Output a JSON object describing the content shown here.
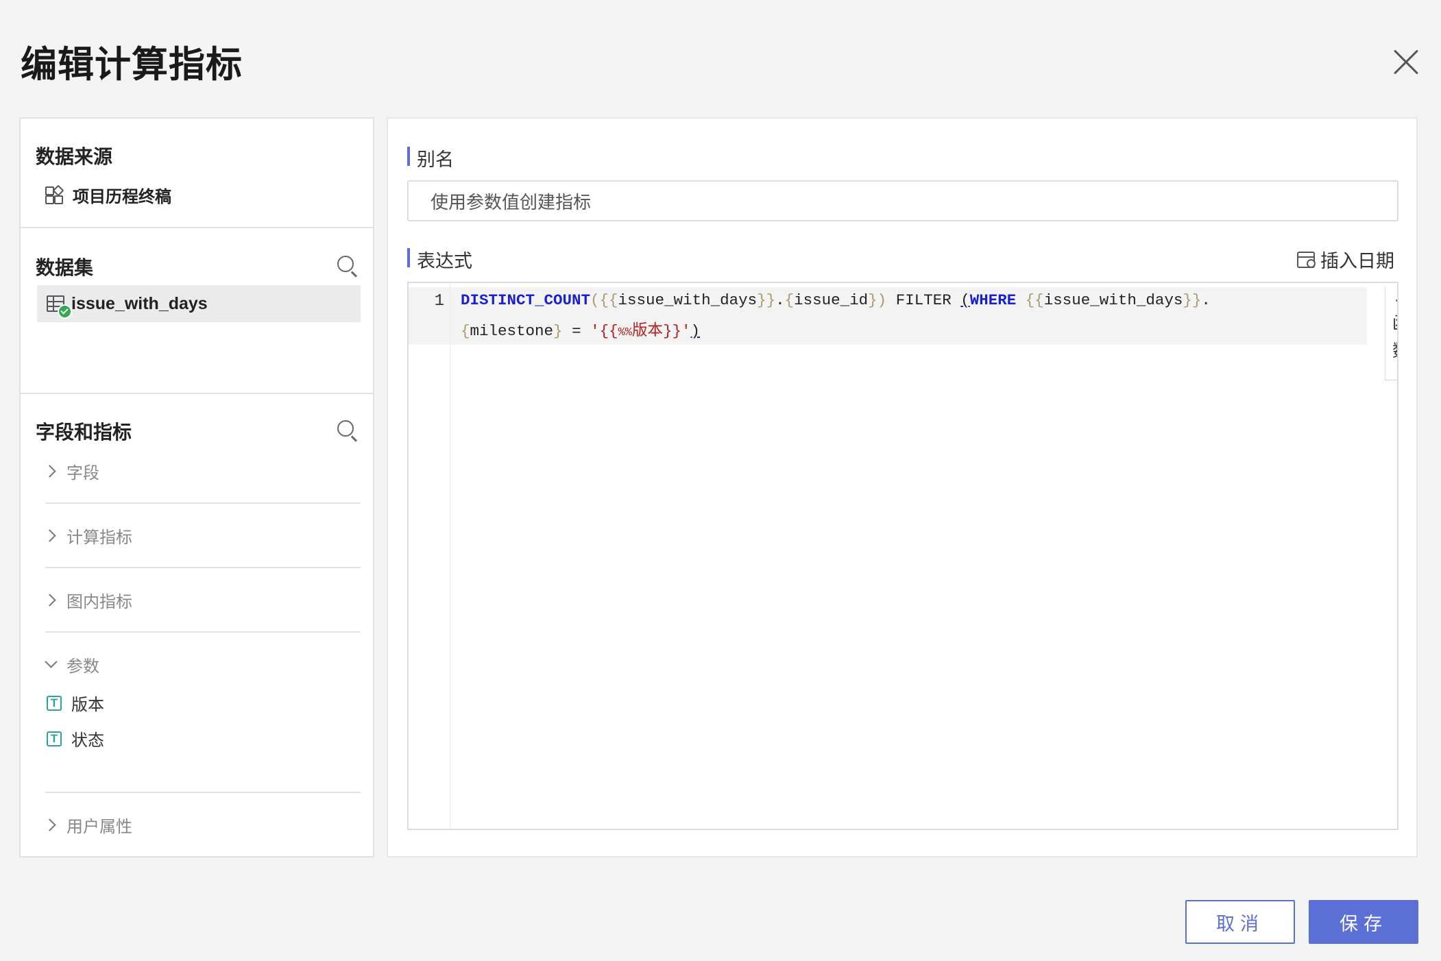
{
  "dialog": {
    "title": "编辑计算指标",
    "close_icon": "close-icon"
  },
  "left_panel": {
    "data_source": {
      "title": "数据来源",
      "item": "项目历程终稿",
      "icon": "apps-grid-icon"
    },
    "dataset": {
      "title": "数据集",
      "search_icon": "search-icon",
      "items": [
        {
          "label": "issue_with_days",
          "icon": "table-icon",
          "status": "connected",
          "selected": true
        }
      ]
    },
    "fields": {
      "title": "字段和指标",
      "search_icon": "search-icon",
      "groups": [
        {
          "label": "字段",
          "expanded": false
        },
        {
          "label": "计算指标",
          "expanded": false
        },
        {
          "label": "图内指标",
          "expanded": false
        },
        {
          "label": "参数",
          "expanded": true,
          "items": [
            {
              "label": "版本",
              "type": "T"
            },
            {
              "label": "状态",
              "type": "T"
            }
          ]
        },
        {
          "label": "用户属性",
          "expanded": false
        }
      ]
    }
  },
  "right_panel": {
    "alias": {
      "label": "别名",
      "value": "使用参数值创建指标"
    },
    "expression": {
      "label": "表达式",
      "insert_date_label": "插入日期",
      "line_number": "1",
      "code": "DISTINCT_COUNT({{issue_with_days}}.{issue_id}) FILTER (WHERE {{issue_with_days}}.{milestone} = '{{%%版本}}')",
      "functions_tab": "函数"
    }
  },
  "footer": {
    "cancel_label": "取消",
    "save_label": "保存"
  },
  "colors": {
    "accent": "#5b6fd6",
    "keyword": "#1a1fcf",
    "string": "#b52020",
    "param_icon": "#2ba39c",
    "status_ok": "#34a853"
  }
}
